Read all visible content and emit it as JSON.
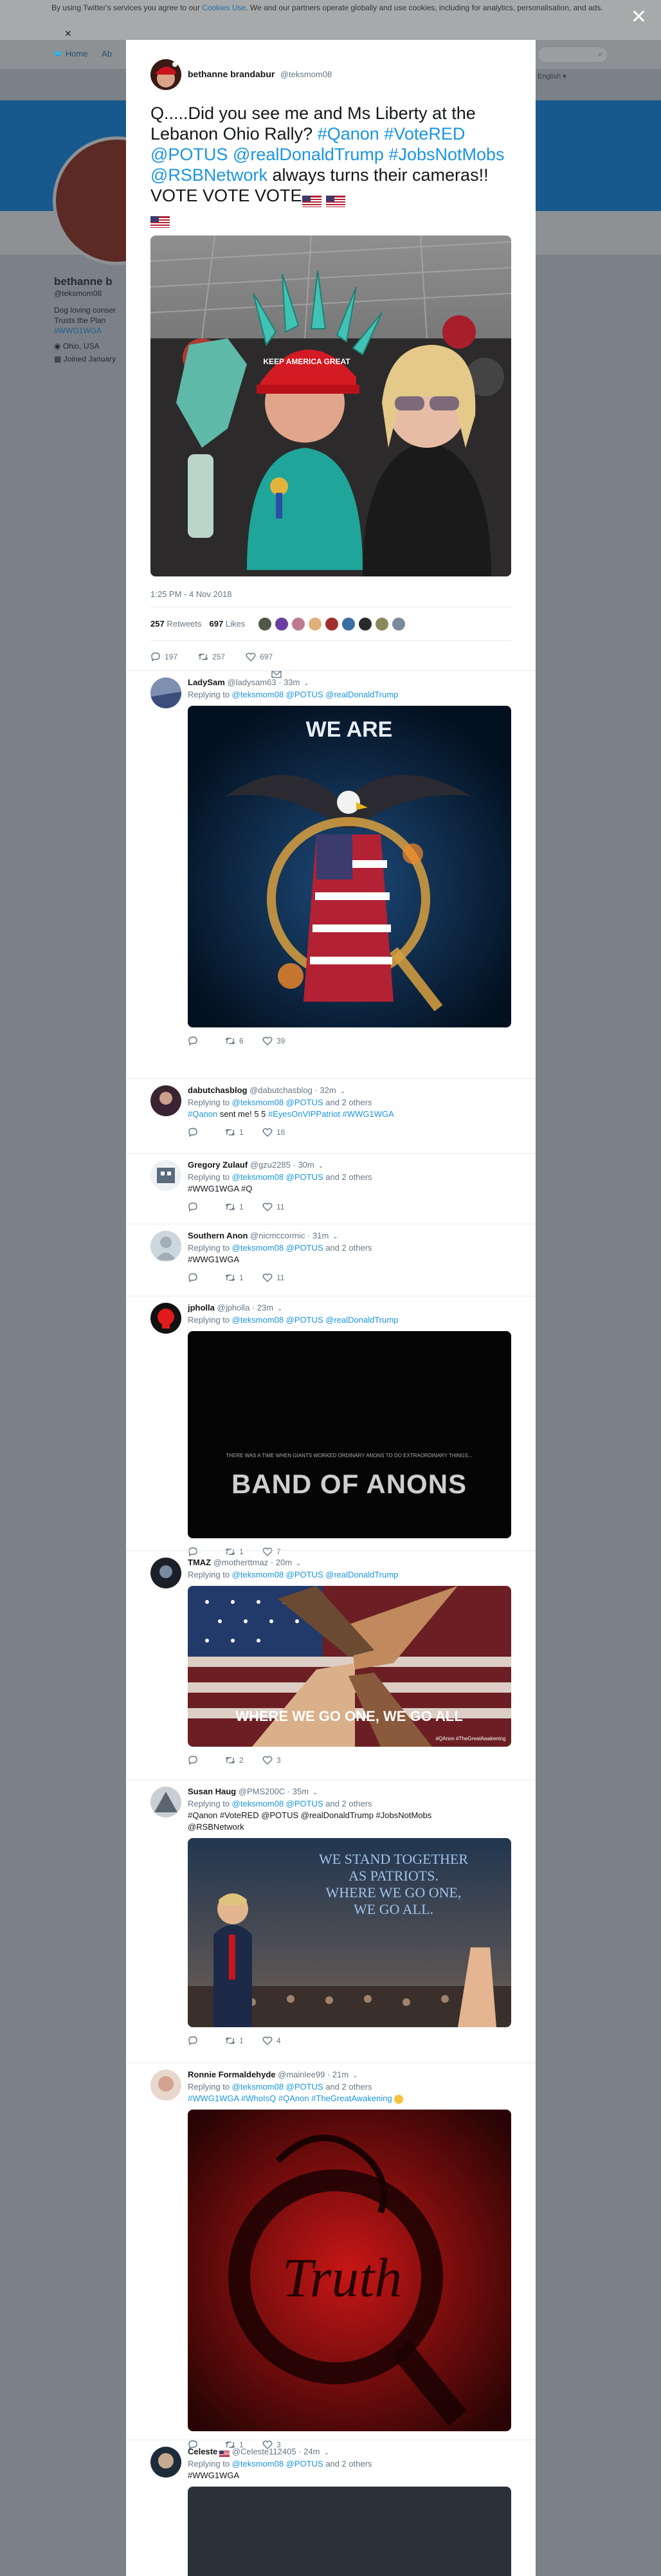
{
  "cookie_banner": {
    "text_before": "By using Twitter's services you agree to our ",
    "cookies_link": "Cookies Use",
    "text_after": ". We and our partners operate globally and use cookies, including for analytics, personalisation, and ads."
  },
  "background": {
    "nav_home": "Home",
    "nav_about": "Ab",
    "lang": "English ▾",
    "profile_name": "bethanne b",
    "profile_handle": "@teksmom08",
    "bio_line1": "Dog loving conser",
    "bio_line2": "Trusts the Plan",
    "bio_tag": "#WWG1WGA",
    "location": "Ohio, USA",
    "joined": "Joined January"
  },
  "tweet": {
    "author_name": "bethanne brandabur",
    "author_handle": "@teksmom08",
    "text_parts": {
      "p1": "Q.....Did you see me and Ms Liberty at the Lebanon Ohio Rally? ",
      "tag1": "#Qanon",
      "tag2": "#VoteRED",
      "mention1": "@POTUS",
      "mention2": "@realDonaldTrump",
      "tag3": "#JobsNotMobs",
      "mention3": "@RSBNetwork",
      "p2": " always turns their cameras!!      VOTE VOTE VOTE"
    },
    "photo_hat_text": "KEEP AMERICA GREAT",
    "timestamp": "1:25 PM - 4 Nov 2018",
    "retweets_count": "257",
    "retweets_label": "Retweets",
    "likes_count": "697",
    "likes_label": "Likes",
    "reply_count": "197",
    "retweet_count": "257",
    "like_count": "697"
  },
  "replies": [
    {
      "name": "LadySam",
      "handle": "@ladysam63",
      "time": "33m",
      "replying_prefix": "Replying to ",
      "mentions": "@teksmom08 @POTUS @realDonaldTrump",
      "others": "",
      "text": "",
      "media_text": "WE ARE",
      "reply_count": "",
      "retweet_count": "6",
      "like_count": "39"
    },
    {
      "name": "dabutchasblog",
      "handle": "@dabutchasblog",
      "time": "32m",
      "replying_prefix": "Replying to ",
      "mentions": "@teksmom08 @POTUS",
      "others": " and 2 others",
      "text_tag1": "#Qanon",
      "text_mid": " sent me! 5 5 ",
      "text_tags2": "#EyesOnVIPPatriot #WWG1WGA",
      "reply_count": "",
      "retweet_count": "1",
      "like_count": "16"
    },
    {
      "name": "Gregory Zulauf",
      "handle": "@gzu2285",
      "time": "30m",
      "replying_prefix": "Replying to ",
      "mentions": "@teksmom08 @POTUS",
      "others": " and 2 others",
      "text_tags": "#WWG1WGA #Q",
      "reply_count": "",
      "retweet_count": "1",
      "like_count": "11"
    },
    {
      "name": "Southern Anon",
      "handle": "@nicmccormic",
      "time": "31m",
      "replying_prefix": "Replying to ",
      "mentions": "@teksmom08 @POTUS",
      "others": " and 2 others",
      "text_tags": "#WWG1WGA",
      "reply_count": "",
      "retweet_count": "1",
      "like_count": "11"
    },
    {
      "name": "jpholla",
      "handle": "@jpholla",
      "time": "23m",
      "replying_prefix": "Replying to ",
      "mentions": "@teksmom08 @POTUS @realDonaldTrump",
      "others": "",
      "media_small": "THERE WAS A TIME WHEN GIANTS WORKED ORDINARY ANONS TO DO EXTRAORDINARY THINGS...",
      "media_big": "BAND OF ANONS",
      "reply_count": "",
      "retweet_count": "1",
      "like_count": "7"
    },
    {
      "name": "TMAZ",
      "handle": "@motherttmaz",
      "time": "20m",
      "replying_prefix": "Replying to ",
      "mentions": "@teksmom08 @POTUS @realDonaldTrump",
      "others": "",
      "media_text": "WHERE WE GO ONE, WE GO ALL",
      "media_small": "#QAnon #TheGreatAwakening",
      "reply_count": "",
      "retweet_count": "2",
      "like_count": "3"
    },
    {
      "name": "Susan Haug",
      "handle": "@PMS200C",
      "time": "35m",
      "replying_prefix": "Replying to ",
      "mentions": "@teksmom08 @POTUS",
      "others": " and 2 others",
      "text_tags": "#Qanon #VoteRED @POTUS @realDonaldTrump #JobsNotMobs @RSBNetwork",
      "media_text": "WE STAND TOGETHER AS PATRIOTS. WHERE WE GO ONE, WE GO ALL.",
      "reply_count": "",
      "retweet_count": "1",
      "like_count": "4"
    },
    {
      "name": "Ronnie Formaldehyde",
      "handle": "@mainlee99",
      "time": "21m",
      "replying_prefix": "Replying to ",
      "mentions": "@teksmom08 @POTUS",
      "others": " and 2 others",
      "text_tags": "#WWG1WGA #WhoIsQ #QAnon #TheGreatAwakening",
      "media_text": "Truth",
      "reply_count": "",
      "retweet_count": "1",
      "like_count": "3"
    },
    {
      "name": "Celeste",
      "handle": "@Celeste112405",
      "time": "24m",
      "replying_prefix": "Replying to ",
      "mentions": "@teksmom08 @POTUS",
      "others": " and 2 others",
      "text_tags": "#WWG1WGA"
    }
  ],
  "colors": {
    "link": "#1b95e0",
    "overlay": "#7b8186",
    "muted": "#657786"
  }
}
